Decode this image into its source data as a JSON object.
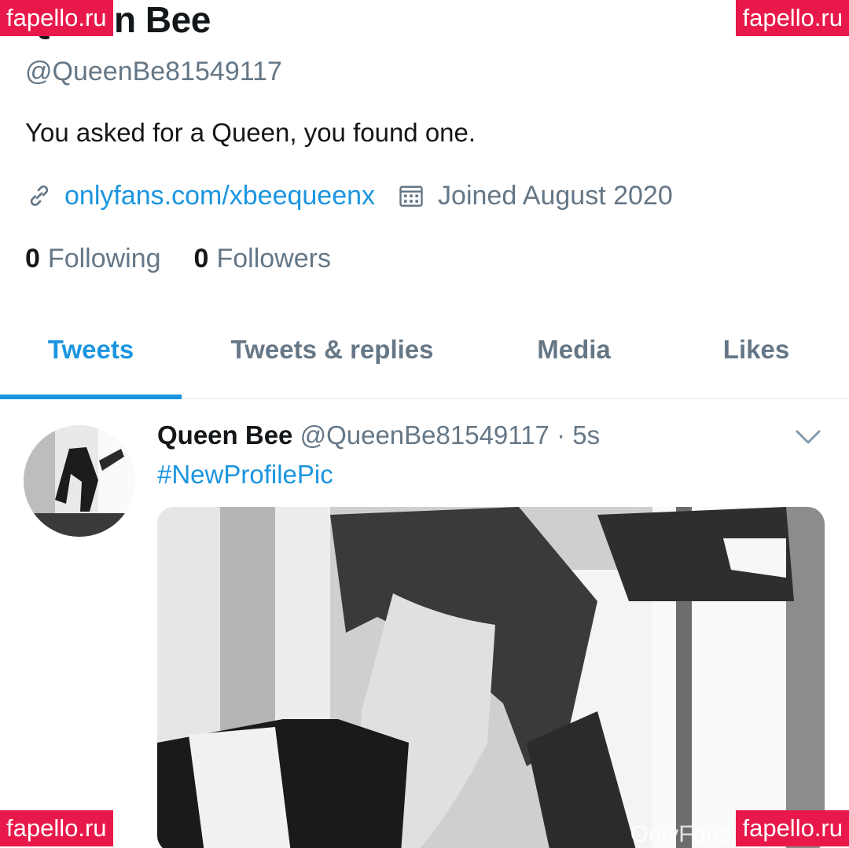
{
  "profile": {
    "name": "Queen Bee",
    "handle": "@QueenBe81549117",
    "bio": "You asked for a Queen, you found one.",
    "link": "onlyfans.com/xbeequeenx",
    "joined": "Joined August 2020",
    "following_count": "0",
    "following_label": "Following",
    "followers_count": "0",
    "followers_label": "Followers"
  },
  "tabs": [
    {
      "label": "Tweets",
      "active": true
    },
    {
      "label": "Tweets & replies",
      "active": false
    },
    {
      "label": "Media",
      "active": false
    },
    {
      "label": "Likes",
      "active": false
    }
  ],
  "tweet": {
    "name": "Queen Bee",
    "handle_time": "@QueenBe81549117 · 5s",
    "text": "#NewProfilePic",
    "media_watermark": "OnlyFans.com/xb"
  },
  "watermarks": {
    "top_left": "fapello.ru",
    "top_right": "fapello.ru",
    "bottom_left": "fapello.ru",
    "bottom_right": "fapello.ru"
  },
  "colors": {
    "accent": "#1b95e0",
    "secondary_text": "#657786",
    "watermark_bg": "#e8194a"
  },
  "icons": {
    "link": "link-icon",
    "calendar": "calendar-icon",
    "chevron": "chevron-down-icon"
  }
}
